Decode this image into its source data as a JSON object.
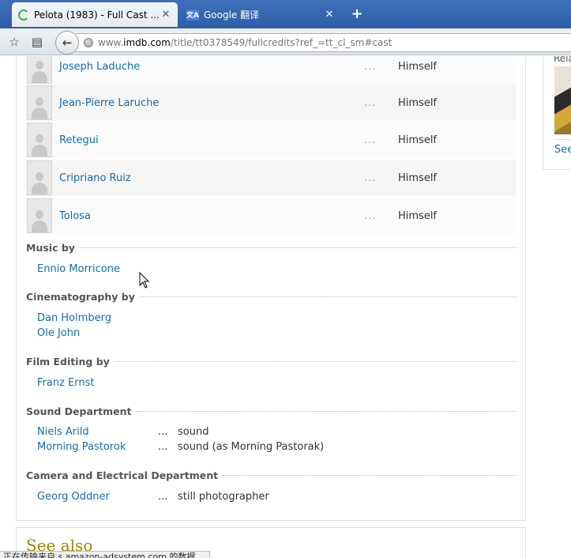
{
  "browser": {
    "tabs": [
      {
        "title": "Pelota (1983) - Full Cast ...",
        "icon": "loading-spinner-icon",
        "active": true
      },
      {
        "title": "Google 翻译",
        "icon": "google-translate-icon",
        "active": false
      }
    ],
    "new_tab_label": "+",
    "url_prefix": "www.",
    "url_host": "imdb.com",
    "url_path": "/title/tt0378549/fullcredits?ref_=tt_cl_sm#cast",
    "status_text": "正在传输来自 s.amazon-adsystem.com 的数据..."
  },
  "cast": [
    {
      "name": "Joseph Laduche",
      "dots": "...",
      "character": "Himself"
    },
    {
      "name": "Jean-Pierre Laruche",
      "dots": "...",
      "character": "Himself"
    },
    {
      "name": "Retegui",
      "dots": "...",
      "character": "Himself"
    },
    {
      "name": "Cripriano Ruiz",
      "dots": "...",
      "character": "Himself"
    },
    {
      "name": "Tolosa",
      "dots": "...",
      "character": "Himself"
    }
  ],
  "sections": {
    "music": {
      "title": "Music by",
      "credits": [
        {
          "name": "Ennio Morricone"
        }
      ]
    },
    "cinematography": {
      "title": "Cinematography by",
      "credits": [
        {
          "name": "Dan Holmberg"
        },
        {
          "name": "Ole John"
        }
      ]
    },
    "editing": {
      "title": "Film Editing by",
      "credits": [
        {
          "name": "Franz Ernst"
        }
      ]
    },
    "sound": {
      "title": "Sound Department",
      "credits": [
        {
          "name": "Niels Arild",
          "dots": "...",
          "role": "sound"
        },
        {
          "name": "Morning Pastorok",
          "dots": "...",
          "role": "sound (as Morning Pastorak)"
        }
      ]
    },
    "camera": {
      "title": "Camera and Electrical Department",
      "credits": [
        {
          "name": "Georg Oddner",
          "dots": "...",
          "role": "still photographer"
        }
      ]
    }
  },
  "see_also": {
    "title": "See also"
  },
  "sidebar": {
    "label": "Rela",
    "link": "See"
  }
}
